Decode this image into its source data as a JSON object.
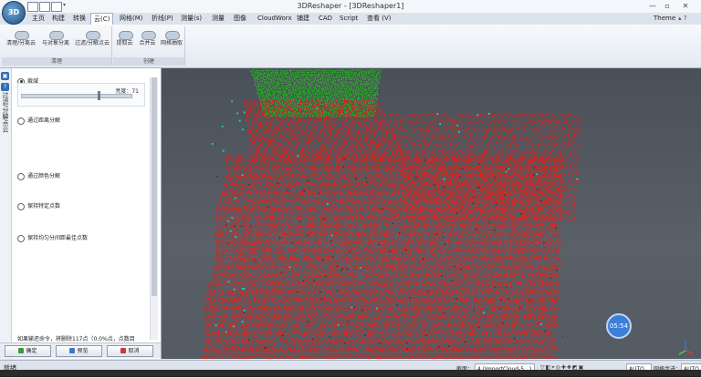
{
  "app": {
    "logo": "3D",
    "title": "3DReshaper - [3DReshaper1]",
    "theme_label": "Theme",
    "window_buttons": [
      "—",
      "▫",
      "✕"
    ]
  },
  "menu": [
    "主页",
    "构建",
    "转换",
    "云(C)",
    "网格(M)",
    "折线(P)",
    "测量(s)",
    "测量",
    "图像",
    "CloudWorx",
    "铺建",
    "CAD",
    "Script",
    "查看 (V)"
  ],
  "ribbon": {
    "groups": [
      {
        "label": "清理",
        "buttons": [
          "清理/分离云",
          "与对象分离",
          "过滤/分解点云"
        ]
      },
      {
        "label": "创建",
        "buttons": [
          "提取云",
          "合并云",
          "网格抽取"
        ]
      }
    ]
  },
  "panel": {
    "vertical_title": "过滤/分解点云",
    "options": [
      {
        "label": "裁域",
        "checked": true
      },
      {
        "label": "通过距离分解",
        "checked": false
      },
      {
        "label": "通过颜色分解",
        "checked": false
      },
      {
        "label": "保持特定点数",
        "checked": false
      },
      {
        "label": "保持均匀分间距最佳点数",
        "checked": false
      }
    ],
    "brightness_label": "亮度：71",
    "brightness_value": 71,
    "result_text": "如果输还命令，将删除117点（0.0%点，点数目",
    "buttons": {
      "ok": "确定",
      "preview": "预览",
      "cancel": "取消"
    }
  },
  "viewport": {
    "timer": "05:54",
    "colors": {
      "kept": "#d9231c",
      "selected": "#22b21f",
      "highlight": "#1fc7c2",
      "background": "#50565e"
    }
  },
  "status": {
    "text": "就绪",
    "prefix": "截面：",
    "cloud_name": "4 (ImportCloud-5...)",
    "mode1": "AUTO",
    "mesh_label": "网格步进：",
    "mode2": "AUTO"
  }
}
